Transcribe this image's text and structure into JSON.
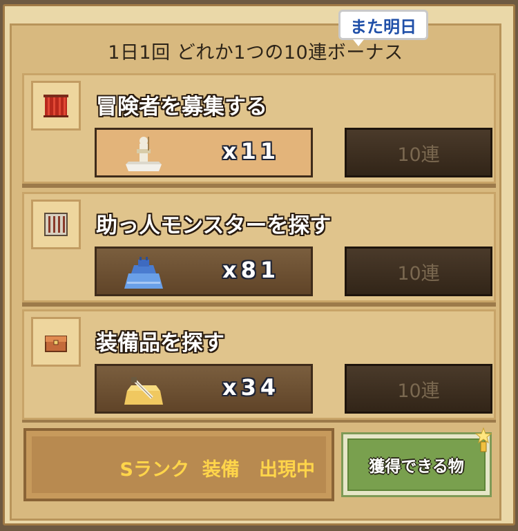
{
  "header": {
    "title": "1日1回  どれか1つの10連ボーナス",
    "tomorrow_badge": "また明日"
  },
  "sections": [
    {
      "title": "冒険者を募集する",
      "icon": "red-curtain-icon",
      "reward_icon": "adventurer-statue-icon",
      "reward_count": "x11",
      "reward_state": "selected",
      "button_label": "10連"
    },
    {
      "title": "助っ人モンスターを探す",
      "icon": "iron-gate-icon",
      "reward_icon": "blue-monster-icon",
      "reward_count": "x81",
      "reward_state": "normal",
      "button_label": "10連"
    },
    {
      "title": "装備品を探す",
      "icon": "treasure-chest-icon",
      "reward_icon": "sword-scroll-icon",
      "reward_count": "x34",
      "reward_state": "normal",
      "button_label": "10連"
    }
  ],
  "footer": {
    "s_rank_text": "Sランク  装備   出現中",
    "get_button_label": "獲得できる物",
    "badge_icon": "star-badge-icon"
  },
  "colors": {
    "accent_text": "#ffd54a",
    "badge_text": "#1f4fa8",
    "get_button_green": "#79a04e"
  }
}
